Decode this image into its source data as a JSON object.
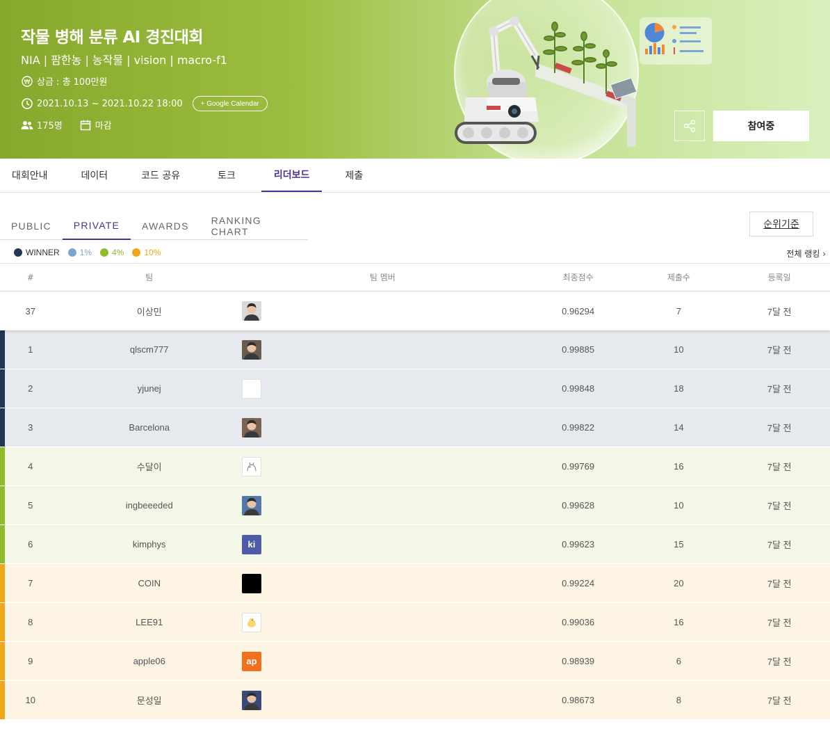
{
  "hero": {
    "title": "작물 병해 분류 AI 경진대회",
    "tags": "NIA | 팜한농 | 농작물 | vision | macro-f1",
    "prize": "상금 : 총 100만원",
    "period": "2021.10.13 ~ 2021.10.22 18:00",
    "calendar_btn": "+ Google Calendar",
    "participants": "175명",
    "status": "마감",
    "join_btn": "참여중",
    "colors": {
      "banner_start": "#86a82c",
      "banner_end": "#d9f0bd"
    }
  },
  "main_tabs": [
    "대회안내",
    "데이터",
    "코드 공유",
    "토크",
    "리더보드",
    "제출"
  ],
  "main_tab_active": "리더보드",
  "sub_tabs": [
    "PUBLIC",
    "PRIVATE",
    "AWARDS",
    "RANKING CHART"
  ],
  "sub_tab_active": "PRIVATE",
  "ranking_criteria_btn": "순위기준",
  "legend": [
    {
      "label": "WINNER",
      "color": "#223655",
      "text_color": "#333333"
    },
    {
      "label": "1%",
      "color": "#7ba6cf",
      "text_color": "#7ba6cf"
    },
    {
      "label": "4%",
      "color": "#8dbd2b",
      "text_color": "#8dbd2b"
    },
    {
      "label": "10%",
      "color": "#efa61a",
      "text_color": "#efa61a"
    }
  ],
  "full_ranking_link": "전체 랭킹 ›",
  "table": {
    "headers": {
      "num": "#",
      "team": "팀",
      "members": "팀 멤버",
      "score": "최종점수",
      "submissions": "제출수",
      "date": "등록일"
    },
    "rows": [
      {
        "num": "37",
        "team": "이상민",
        "score": "0.96294",
        "subs": "7",
        "date": "7달 전",
        "tier": "mine",
        "avatar": {
          "kind": "photo",
          "bg": "#d9d9d9",
          "label": ""
        }
      },
      {
        "num": "1",
        "team": "qlscm777",
        "score": "0.99885",
        "subs": "10",
        "date": "7달 전",
        "tier": "winner",
        "avatar": {
          "kind": "photo",
          "bg": "#6b5a4e",
          "label": ""
        }
      },
      {
        "num": "2",
        "team": "yjunej",
        "score": "0.99848",
        "subs": "18",
        "date": "7달 전",
        "tier": "winner",
        "avatar": {
          "kind": "blank",
          "bg": "#ffffff",
          "label": ""
        }
      },
      {
        "num": "3",
        "team": "Barcelona",
        "score": "0.99822",
        "subs": "14",
        "date": "7달 전",
        "tier": "winner",
        "avatar": {
          "kind": "photo",
          "bg": "#7a6150",
          "label": ""
        }
      },
      {
        "num": "4",
        "team": "수달이",
        "score": "0.99769",
        "subs": "16",
        "date": "7달 전",
        "tier": "p4",
        "avatar": {
          "kind": "sketch",
          "bg": "#ffffff",
          "label": ""
        }
      },
      {
        "num": "5",
        "team": "ingbeeeded",
        "score": "0.99628",
        "subs": "10",
        "date": "7달 전",
        "tier": "p4",
        "avatar": {
          "kind": "photo",
          "bg": "#5577aa",
          "label": ""
        }
      },
      {
        "num": "6",
        "team": "kimphys",
        "score": "0.99623",
        "subs": "15",
        "date": "7달 전",
        "tier": "p4",
        "avatar": {
          "kind": "text",
          "bg": "#4e5ba6",
          "label": "ki"
        }
      },
      {
        "num": "7",
        "team": "COIN",
        "score": "0.99224",
        "subs": "20",
        "date": "7달 전",
        "tier": "p10",
        "avatar": {
          "kind": "solid",
          "bg": "#000000",
          "label": ""
        }
      },
      {
        "num": "8",
        "team": "LEE91",
        "score": "0.99036",
        "subs": "16",
        "date": "7달 전",
        "tier": "p10",
        "avatar": {
          "kind": "chick",
          "bg": "#ffffff",
          "label": ""
        }
      },
      {
        "num": "9",
        "team": "apple06",
        "score": "0.98939",
        "subs": "6",
        "date": "7달 전",
        "tier": "p10",
        "avatar": {
          "kind": "text",
          "bg": "#f07020",
          "label": "ap"
        }
      },
      {
        "num": "10",
        "team": "문성일",
        "score": "0.98673",
        "subs": "8",
        "date": "7달 전",
        "tier": "p10",
        "avatar": {
          "kind": "photo",
          "bg": "#3a4a78",
          "label": ""
        }
      }
    ]
  }
}
